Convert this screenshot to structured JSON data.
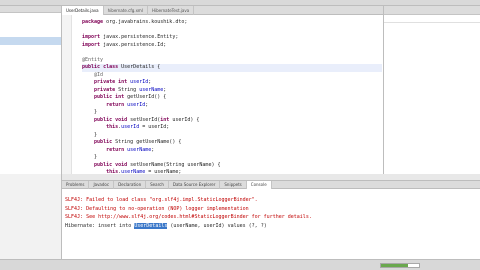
{
  "editor": {
    "tabs": [
      {
        "label": "UserDetails.java",
        "active": true
      },
      {
        "label": "hibernate.cfg.xml",
        "active": false
      },
      {
        "label": "HibernateTest.java",
        "active": false
      }
    ],
    "code_lines": [
      [
        {
          "t": "package ",
          "c": "kw"
        },
        {
          "t": "org.javabrains.koushik.dto;",
          "c": ""
        }
      ],
      [
        {
          "t": "",
          "c": ""
        }
      ],
      [
        {
          "t": "import ",
          "c": "kw"
        },
        {
          "t": "javax.persistence.Entity;",
          "c": ""
        }
      ],
      [
        {
          "t": "import ",
          "c": "kw"
        },
        {
          "t": "javax.persistence.Id;",
          "c": ""
        }
      ],
      [
        {
          "t": "",
          "c": ""
        }
      ],
      [
        {
          "t": "@Entity",
          "c": "ann"
        }
      ],
      [
        {
          "t": "public class ",
          "c": "kw"
        },
        {
          "t": "UserDetails {",
          "c": ""
        }
      ],
      [
        {
          "t": "    @Id",
          "c": "ann"
        }
      ],
      [
        {
          "t": "    private int ",
          "c": "kw"
        },
        {
          "t": "userId",
          "c": "fld"
        },
        {
          "t": ";",
          "c": ""
        }
      ],
      [
        {
          "t": "    private ",
          "c": "kw"
        },
        {
          "t": "String ",
          "c": ""
        },
        {
          "t": "userName",
          "c": "fld"
        },
        {
          "t": ";",
          "c": ""
        }
      ],
      [
        {
          "t": "    public int ",
          "c": "kw"
        },
        {
          "t": "getUserId() {",
          "c": ""
        }
      ],
      [
        {
          "t": "        return ",
          "c": "kw"
        },
        {
          "t": "userId",
          "c": "fld"
        },
        {
          "t": ";",
          "c": ""
        }
      ],
      [
        {
          "t": "    }",
          "c": ""
        }
      ],
      [
        {
          "t": "    public void ",
          "c": "kw"
        },
        {
          "t": "setUserId(",
          "c": ""
        },
        {
          "t": "int ",
          "c": "kw"
        },
        {
          "t": "userId) {",
          "c": ""
        }
      ],
      [
        {
          "t": "        this",
          "c": "kw"
        },
        {
          "t": ".",
          "c": ""
        },
        {
          "t": "userId",
          "c": "fld"
        },
        {
          "t": " = userId;",
          "c": ""
        }
      ],
      [
        {
          "t": "    }",
          "c": ""
        }
      ],
      [
        {
          "t": "    public ",
          "c": "kw"
        },
        {
          "t": "String getUserName() {",
          "c": ""
        }
      ],
      [
        {
          "t": "        return ",
          "c": "kw"
        },
        {
          "t": "userName",
          "c": "fld"
        },
        {
          "t": ";",
          "c": ""
        }
      ],
      [
        {
          "t": "    }",
          "c": ""
        }
      ],
      [
        {
          "t": "    public void ",
          "c": "kw"
        },
        {
          "t": "setUserName(String userName) {",
          "c": ""
        }
      ],
      [
        {
          "t": "        this",
          "c": "kw"
        },
        {
          "t": ".",
          "c": ""
        },
        {
          "t": "userName",
          "c": "fld"
        },
        {
          "t": " = userName;",
          "c": ""
        }
      ]
    ]
  },
  "bottom": {
    "tabs": [
      {
        "label": "Problems",
        "active": false
      },
      {
        "label": "Javadoc",
        "active": false
      },
      {
        "label": "Declaration",
        "active": false
      },
      {
        "label": "Search",
        "active": false
      },
      {
        "label": "Data Source Explorer",
        "active": false
      },
      {
        "label": "Snippets",
        "active": false
      },
      {
        "label": "Console",
        "active": true
      }
    ],
    "console_lines": [
      {
        "kind": "err",
        "text": "SLF4J: Failed to load class \"org.slf4j.impl.StaticLoggerBinder\"."
      },
      {
        "kind": "err",
        "text": "SLF4J: Defaulting to no-operation (NOP) logger implementation"
      },
      {
        "kind": "err",
        "text": "SLF4J: See http://www.slf4j.org/codes.html#StaticLoggerBinder for further details."
      }
    ],
    "console_last": {
      "before": "Hibernate: insert into ",
      "selected": "UserDetails",
      "after": " (userName, userId) values (?, ?)"
    }
  },
  "colors": {
    "keyword": "#7f0055",
    "field": "#0000c0",
    "error": "#c00000",
    "selection": "#3b78c9"
  }
}
